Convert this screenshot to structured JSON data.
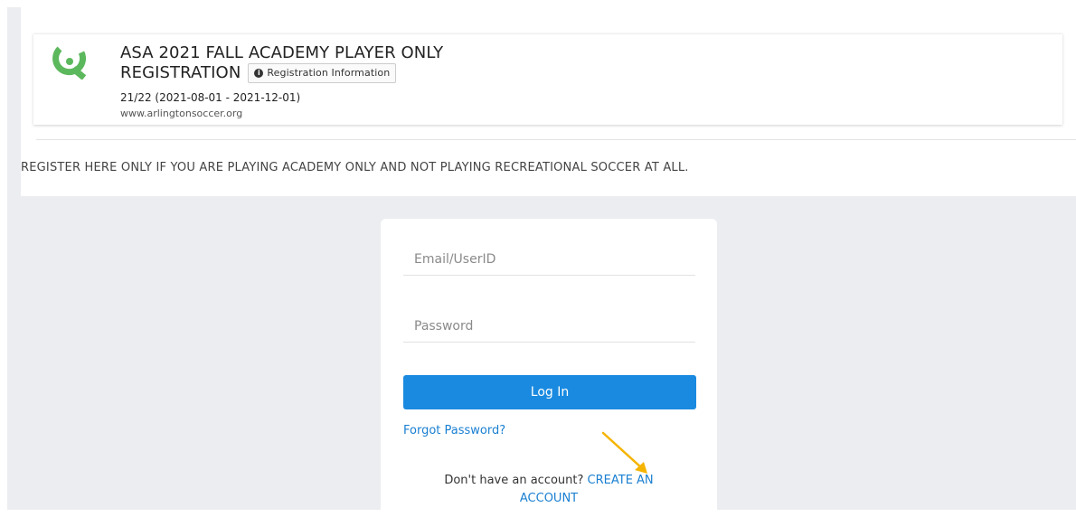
{
  "header": {
    "title_line1": "ASA 2021 FALL ACADEMY PLAYER ONLY",
    "title_line2": "REGISTRATION",
    "registration_info_label": "Registration Information",
    "season": "21/22 (2021-08-01 - 2021-12-01)",
    "website": "www.arlingtonsoccer.org"
  },
  "notice": "REGISTER HERE ONLY IF YOU ARE PLAYING ACADEMY ONLY AND NOT PLAYING RECREATIONAL SOCCER AT ALL.",
  "login": {
    "email_placeholder": "Email/UserID",
    "password_placeholder": "Password",
    "login_button": "Log In",
    "forgot_password": "Forgot Password?",
    "no_account_text": "Don't have an account?",
    "create_account": "CREATE AN ACCOUNT"
  },
  "colors": {
    "accent": "#1a8ae0",
    "link": "#1a7fd1",
    "logo": "#5cb85c",
    "annotation_arrow": "#f5b400",
    "background": "#ebedf0"
  },
  "icons": {
    "logo": "club-logo-icon",
    "info": "info-circle-icon",
    "annotation": "arrow-pointer-icon"
  }
}
